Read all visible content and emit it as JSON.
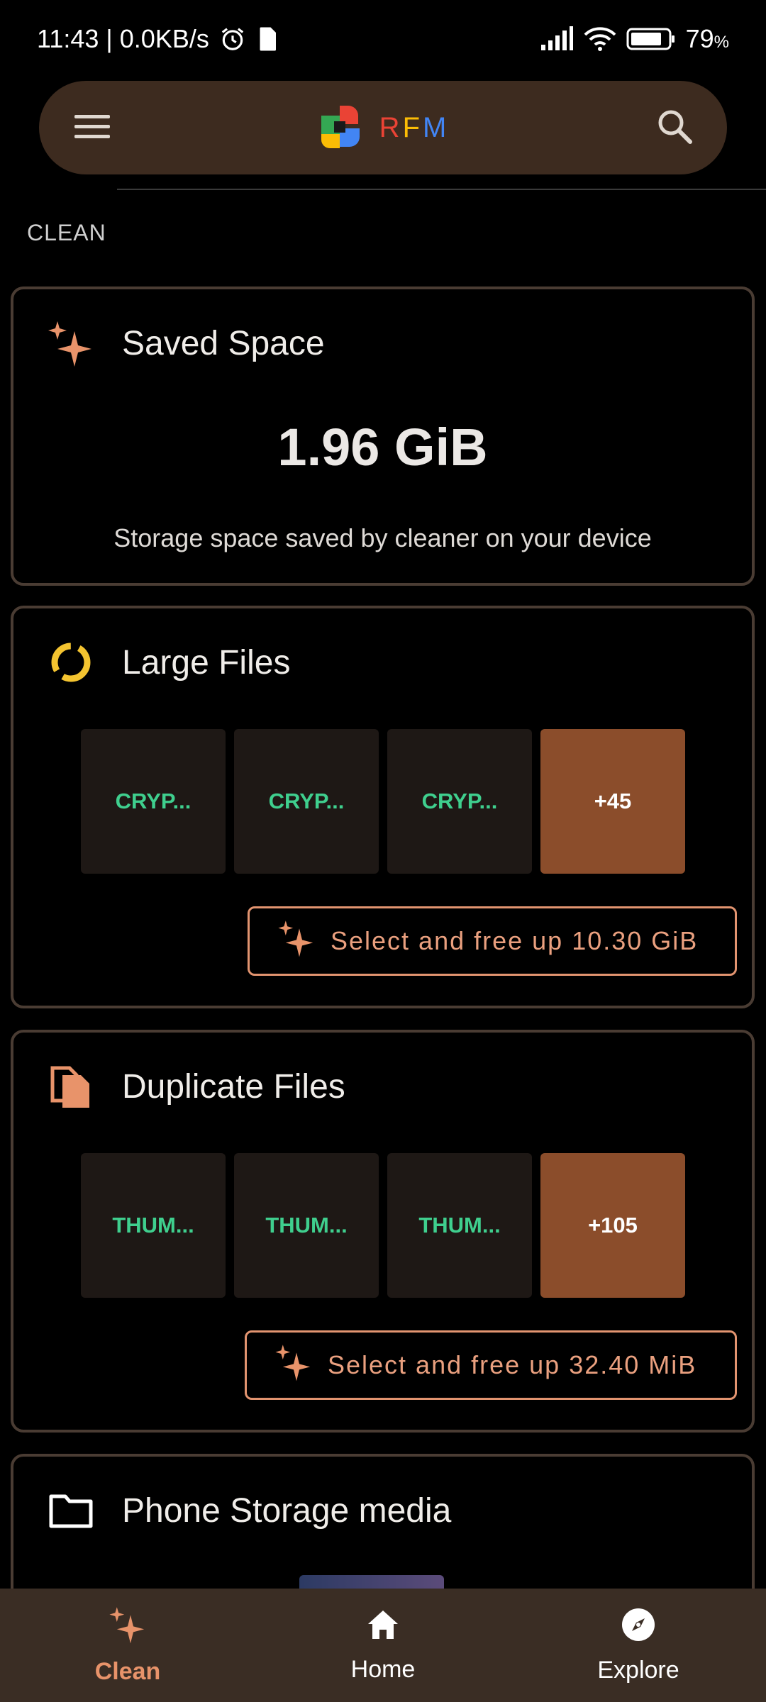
{
  "status_bar": {
    "time_speed": "11:43 | 0.0KB/s",
    "battery": "79",
    "battery_unit": "%"
  },
  "app_bar": {
    "menu_icon": "menu-icon",
    "app_name_r": "R",
    "app_name_f": "F",
    "app_name_m": "M",
    "search_icon": "search-icon"
  },
  "section": {
    "label": "CLEAN"
  },
  "saved_space": {
    "title": "Saved Space",
    "value": "1.96 GiB",
    "description": "Storage space saved by cleaner on your device",
    "icon": "sparkle-icon",
    "icon_color": "#e8936a"
  },
  "large_files": {
    "title": "Large Files",
    "icon": "loading-ring-icon",
    "icon_color": "#f4c430",
    "tiles": [
      "CRYP...",
      "CRYP...",
      "CRYP..."
    ],
    "more": "+45",
    "action": "Select and free up 10.30 GiB"
  },
  "duplicate_files": {
    "title": "Duplicate Files",
    "icon": "duplicate-file-icon",
    "icon_color": "#e8936a",
    "tiles": [
      "THUM...",
      "THUM...",
      "THUM..."
    ],
    "more": "+105",
    "action": "Select and free up 32.40 MiB"
  },
  "phone_storage": {
    "title": "Phone Storage media",
    "icon": "folder-icon"
  },
  "bottom_nav": {
    "items": [
      {
        "label": "Clean",
        "icon": "sparkle-icon",
        "active": true
      },
      {
        "label": "Home",
        "icon": "home-icon",
        "active": false
      },
      {
        "label": "Explore",
        "icon": "compass-icon",
        "active": false
      }
    ]
  },
  "colors": {
    "accent": "#e8936a",
    "tile_text": "#3fcf8e",
    "more_tile": "#8b4d2b",
    "app_bar": "#3d2b1f",
    "card_border": "#4a3c33"
  }
}
